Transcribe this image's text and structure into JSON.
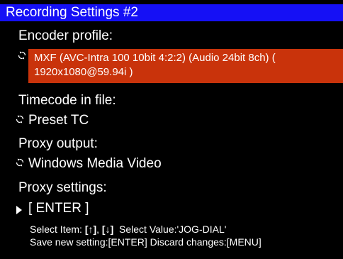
{
  "title": "Recording Settings #2",
  "items": [
    {
      "label": "Encoder profile:",
      "value": "MXF (AVC-Intra 100 10bit 4:2:2) (Audio 24bit 8ch) ( 1920x1080@59.94i )",
      "icon": "cycle-icon",
      "highlighted": true
    },
    {
      "label": "Timecode in file:",
      "value": "Preset TC",
      "icon": "cycle-icon"
    },
    {
      "label": "Proxy output:",
      "value": "Windows Media Video",
      "icon": "cycle-icon"
    },
    {
      "label": "Proxy settings:",
      "value": "[ ENTER ]",
      "icon": "right-triangle-icon"
    }
  ],
  "help": {
    "select_item": "Select Item:",
    "up_key": "[↑]",
    "comma": ",",
    "down_key": "[↓]",
    "select_value": "Select Value:'JOG-DIAL'",
    "line2": "Save new setting:[ENTER] Discard changes:[MENU]"
  },
  "colors": {
    "title_bar": "#1510f5",
    "highlight": "#c9330b",
    "background": "#000000",
    "text": "#ffffff"
  }
}
